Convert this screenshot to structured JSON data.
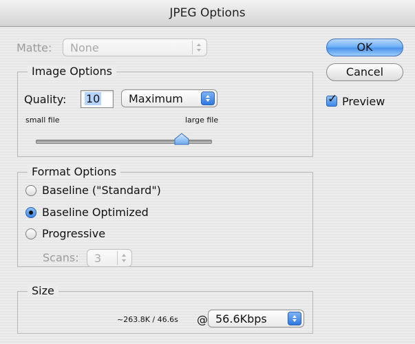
{
  "window": {
    "title": "JPEG Options"
  },
  "matte": {
    "label": "Matte:",
    "value": "None"
  },
  "image_options": {
    "legend": "Image Options",
    "quality_label": "Quality:",
    "quality_value": "10",
    "quality_preset": "Maximum",
    "small_file_label": "small file",
    "large_file_label": "large file",
    "slider_value": 10,
    "slider_max": 12
  },
  "format_options": {
    "legend": "Format Options",
    "options": [
      {
        "label": "Baseline (\"Standard\")",
        "selected": false
      },
      {
        "label": "Baseline Optimized",
        "selected": true
      },
      {
        "label": "Progressive",
        "selected": false
      }
    ],
    "scans_label": "Scans:",
    "scans_value": "3"
  },
  "size": {
    "legend": "Size",
    "estimate": "~263.8K / 46.6s",
    "at_symbol": "@",
    "speed": "56.6Kbps"
  },
  "buttons": {
    "ok": "OK",
    "cancel": "Cancel"
  },
  "preview": {
    "label": "Preview",
    "checked": true
  },
  "colors": {
    "accent": "#3d86e6",
    "background": "#ececec"
  }
}
